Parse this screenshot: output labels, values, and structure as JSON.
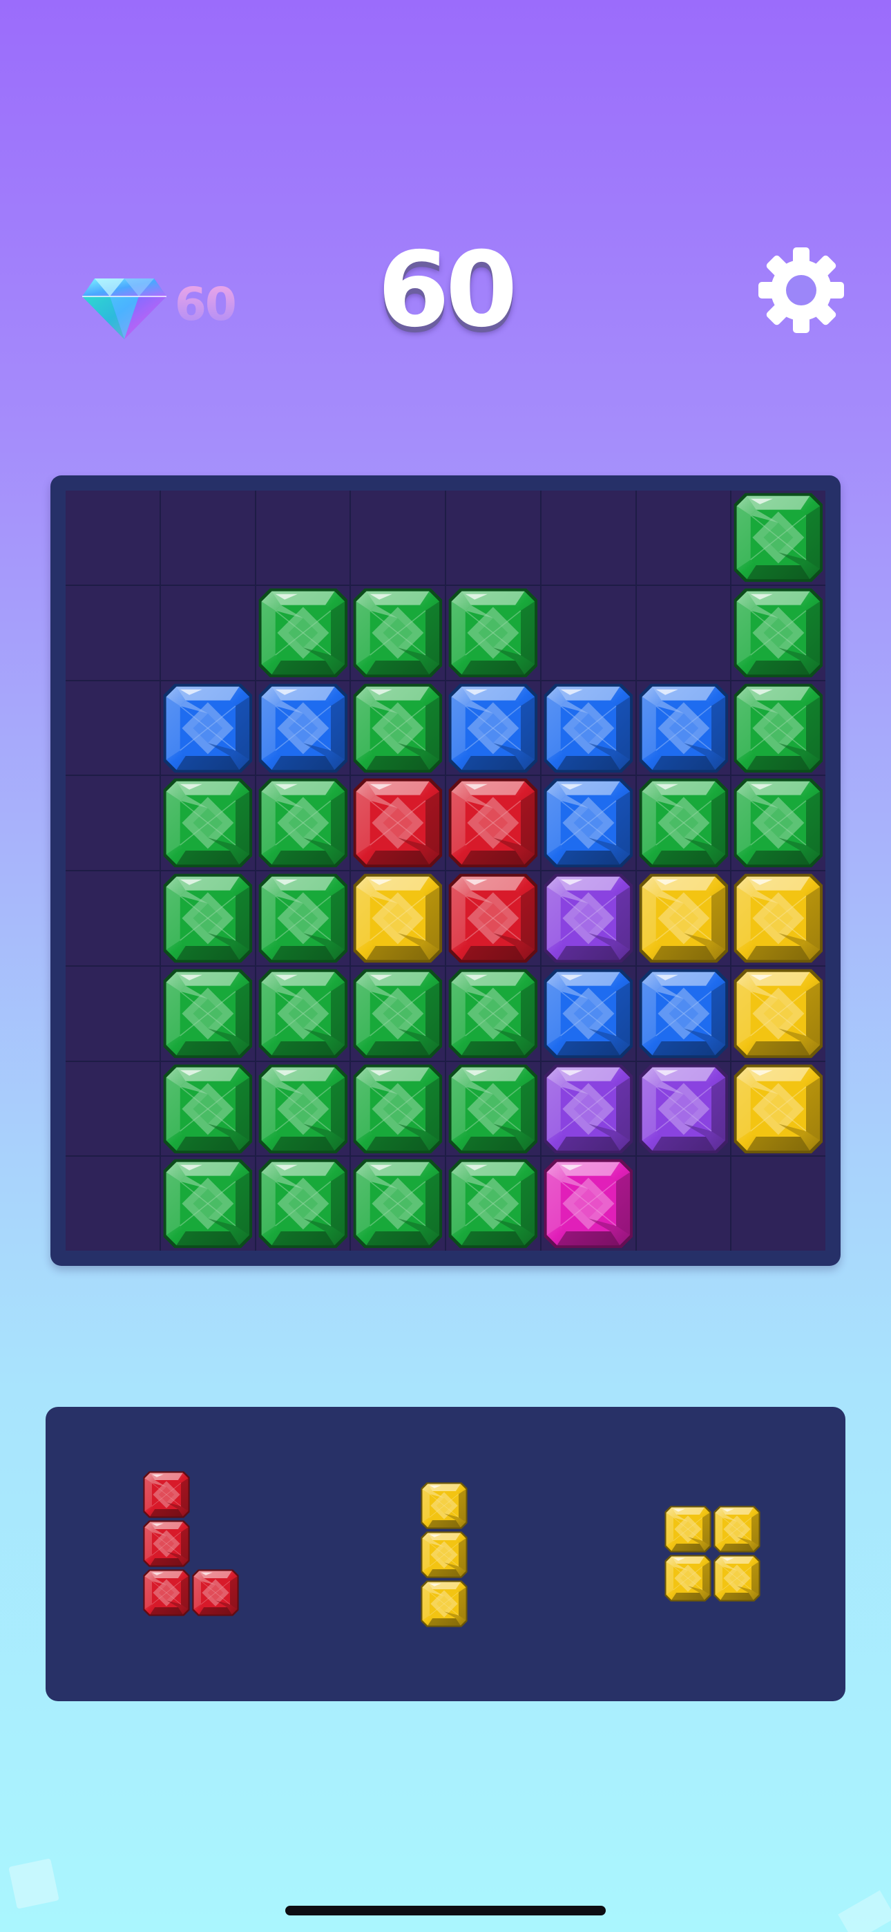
{
  "header": {
    "gem_count": "60",
    "score": "60",
    "gem_icon": "diamond-icon",
    "settings_icon": "gear-icon"
  },
  "colors": {
    "green": "#18a93a",
    "blue": "#1e6cf0",
    "red": "#d81a2a",
    "yellow": "#f3c412",
    "purple": "#8a43e0",
    "pink": "#e11fb9",
    "board_frame": "#263068",
    "board_cell": "#2f2359",
    "tray": "#283167"
  },
  "board": {
    "columns": 8,
    "rows": 8,
    "cells": [
      [
        "",
        "",
        "",
        "",
        "",
        "",
        "",
        "green"
      ],
      [
        "",
        "",
        "green",
        "green",
        "green",
        "",
        "",
        "green"
      ],
      [
        "",
        "blue",
        "blue",
        "green",
        "blue",
        "blue",
        "blue",
        "green"
      ],
      [
        "",
        "green",
        "green",
        "red",
        "red",
        "blue",
        "green",
        "green"
      ],
      [
        "",
        "green",
        "green",
        "yellow",
        "red",
        "purple",
        "yellow",
        "yellow"
      ],
      [
        "",
        "green",
        "green",
        "green",
        "green",
        "blue",
        "blue",
        "yellow"
      ],
      [
        "",
        "green",
        "green",
        "green",
        "green",
        "purple",
        "purple",
        "yellow"
      ],
      [
        "",
        "green",
        "green",
        "green",
        "green",
        "pink",
        "",
        ""
      ]
    ]
  },
  "tray": {
    "pieces": [
      {
        "name": "l-piece",
        "color": "red",
        "shape": [
          [
            1,
            0
          ],
          [
            1,
            0
          ],
          [
            1,
            1
          ]
        ]
      },
      {
        "name": "bar-piece",
        "color": "yellow",
        "shape": [
          [
            1
          ],
          [
            1
          ],
          [
            1
          ]
        ]
      },
      {
        "name": "square-piece",
        "color": "yellow",
        "shape": [
          [
            1,
            1
          ],
          [
            1,
            1
          ]
        ]
      }
    ]
  }
}
